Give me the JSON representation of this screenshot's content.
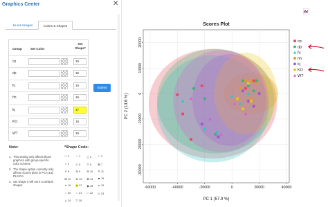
{
  "panel": {
    "title": "Graphics Center",
    "close": "✕",
    "tabs": [
      "Hi-res Images",
      "Colors & Shapes"
    ],
    "active_tab": "Colors & Shapes",
    "table_headers": {
      "group": "Group",
      "color": "Set Color",
      "shape": "Set Shape*"
    },
    "rows": [
      {
        "group": "cp",
        "shape": "15",
        "highlight": false
      },
      {
        "group": "dp",
        "shape": "15",
        "highlight": false
      },
      {
        "group": "fu",
        "shape": "15",
        "highlight": false
      },
      {
        "group": "hh",
        "shape": "15",
        "highlight": false
      },
      {
        "group": "kj",
        "shape": "17",
        "highlight": true
      },
      {
        "group": "KO",
        "shape": "15",
        "highlight": false
      },
      {
        "group": "WT",
        "shape": "15",
        "highlight": false
      }
    ],
    "submit_label": "Submit",
    "note_heading": "Note:",
    "notes": [
      {
        "n": "1.",
        "text": "This setting only affects those graphics with group-specific color scheme"
      },
      {
        "n": "2.",
        "text": "The shape option currently only affects scores plots in PCA and PLS-DA"
      },
      {
        "n": "3.",
        "text": "Set shape 0 will set it to default shapes"
      }
    ],
    "shape_code_heading": "*Shape Code:",
    "shape_codes": [
      {
        "code": "0",
        "glyph": "□"
      },
      {
        "code": "1",
        "glyph": "○"
      },
      {
        "code": "2",
        "glyph": "△"
      },
      {
        "code": "3",
        "glyph": "+"
      },
      {
        "code": "4",
        "glyph": "×"
      },
      {
        "code": "5",
        "glyph": "◇"
      },
      {
        "code": "6",
        "glyph": "▽"
      },
      {
        "code": "7",
        "glyph": "⊠"
      },
      {
        "code": "8",
        "glyph": "✳"
      },
      {
        "code": "9",
        "glyph": "⊕"
      },
      {
        "code": "10",
        "glyph": "⊕"
      },
      {
        "code": "11",
        "glyph": "✡"
      },
      {
        "code": "12",
        "glyph": "⊞"
      },
      {
        "code": "13",
        "glyph": "⊗"
      },
      {
        "code": "14",
        "glyph": "⊠"
      },
      {
        "code": "15",
        "glyph": "■"
      },
      {
        "code": "16",
        "glyph": "●"
      },
      {
        "code": "17",
        "glyph": "▲"
      },
      {
        "code": "18",
        "glyph": "◆"
      },
      {
        "code": "19",
        "glyph": "●"
      },
      {
        "code": "20",
        "glyph": "•"
      },
      {
        "code": "21",
        "glyph": "○"
      },
      {
        "code": "22",
        "glyph": "□"
      },
      {
        "code": "23",
        "glyph": "◇"
      },
      {
        "code": "24",
        "glyph": "△"
      },
      {
        "code": "25",
        "glyph": "▽"
      }
    ],
    "highlight_code": "17"
  },
  "colors": {
    "accent": "#2a6fb5",
    "submit": "#2f8be6",
    "highlight": "#ffff33",
    "annotation_arrow": "#d0021b"
  },
  "chart_data": {
    "type": "scatter",
    "title": "Scores Plot",
    "xlabel": "PC 1 (57.9 %)",
    "ylabel": "PC 2 (13.6 %)",
    "xlim": [
      -65000,
      42000
    ],
    "ylim": [
      -35000,
      25000
    ],
    "xticks": [
      -60000,
      -40000,
      -20000,
      0,
      20000,
      40000
    ],
    "yticks": [
      -30000,
      -20000,
      -10000,
      0,
      10000,
      20000
    ],
    "grid": true,
    "legend_position": "right",
    "series": [
      {
        "name": "cp",
        "color": "#e64b5d",
        "shape": "square",
        "ellipse": {
          "cx": -14000,
          "cy": -4000,
          "rx": 47000,
          "ry": 21500
        },
        "points": [
          [
            -40000,
            -500
          ],
          [
            -36000,
            -8000
          ],
          [
            -30000,
            -18000
          ],
          [
            -22000,
            3000
          ],
          [
            -10000,
            -17000
          ],
          [
            10000,
            2000
          ],
          [
            16000,
            5000
          ]
        ]
      },
      {
        "name": "dp",
        "color": "#3cb371",
        "shape": "circle",
        "ellipse": {
          "cx": -12000,
          "cy": -3000,
          "rx": 43000,
          "ry": 20500
        },
        "points": [
          [
            -28000,
            2000
          ],
          [
            -20000,
            -2000
          ],
          [
            -12000,
            -16000
          ],
          [
            8000,
            5000
          ],
          [
            12000,
            3000
          ],
          [
            16000,
            1000
          ],
          [
            18000,
            5000
          ]
        ]
      },
      {
        "name": "fu",
        "color": "#2ec4c4",
        "shape": "triangle",
        "ellipse": {
          "cx": -14000,
          "cy": -6000,
          "rx": 41000,
          "ry": 21000
        },
        "points": [
          [
            -36000,
            -3000
          ],
          [
            -20000,
            -14000
          ],
          [
            -11000,
            -15000
          ],
          [
            0,
            -1000
          ],
          [
            6000,
            -4000
          ],
          [
            12000,
            0
          ]
        ]
      },
      {
        "name": "hh",
        "color": "#d89b2d",
        "shape": "square",
        "ellipse": {
          "cx": 14000,
          "cy": 0,
          "rx": 20000,
          "ry": 8000
        },
        "points": [
          [
            6000,
            2000
          ],
          [
            10000,
            5000
          ],
          [
            14000,
            5000
          ],
          [
            18000,
            4000
          ],
          [
            14000,
            -2000
          ]
        ]
      },
      {
        "name": "kj",
        "color": "#9b59d0",
        "shape": "circle",
        "ellipse": {
          "cx": -2000,
          "cy": -2500,
          "rx": 27000,
          "ry": 18000
        },
        "points": [
          [
            -22000,
            -12000
          ],
          [
            -10000,
            -17000
          ],
          [
            8000,
            1000
          ],
          [
            12000,
            -3000
          ],
          [
            16000,
            -5000
          ],
          [
            20000,
            0
          ]
        ]
      },
      {
        "name": "KO",
        "color": "#e8c61a",
        "shape": "square",
        "ellipse": {
          "cx": 10000,
          "cy": 0,
          "rx": 23000,
          "ry": 16000
        },
        "points": [
          [
            4000,
            -2000
          ],
          [
            8000,
            -6000
          ],
          [
            14000,
            -3000
          ],
          [
            12000,
            4000
          ]
        ]
      },
      {
        "name": "WT",
        "color": "#e05ad0",
        "shape": "triangle",
        "ellipse": {
          "cx": -8000,
          "cy": -3000,
          "rx": 35000,
          "ry": 20000
        },
        "points": [
          [
            -30000,
            -2000
          ],
          [
            -16000,
            -10000
          ],
          [
            -8000,
            -16000
          ],
          [
            2000,
            -4000
          ],
          [
            10000,
            -8000
          ]
        ]
      }
    ],
    "annotation_arrows": [
      "dp",
      "KO"
    ]
  }
}
